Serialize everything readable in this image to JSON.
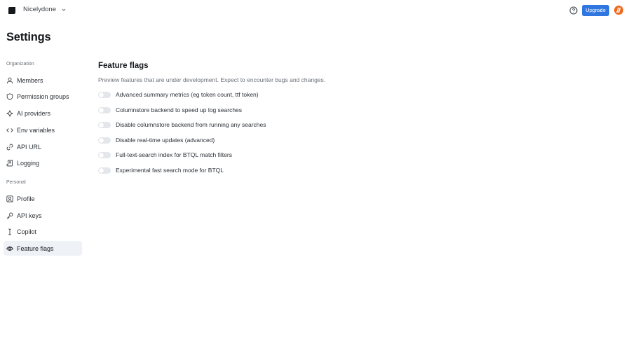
{
  "header": {
    "org_name": "Nicelydone",
    "upgrade_label": "Upgrade",
    "accent_color": "#2f76e0",
    "avatar_color": "#f0681e"
  },
  "page": {
    "title": "Settings"
  },
  "sidebar": {
    "organization_label": "Organization",
    "organization_items": [
      {
        "label": "Members",
        "icon": "user-icon"
      },
      {
        "label": "Permission groups",
        "icon": "shield-icon"
      },
      {
        "label": "AI providers",
        "icon": "sparkle-icon"
      },
      {
        "label": "Env variables",
        "icon": "code-icon"
      },
      {
        "label": "API URL",
        "icon": "link-icon"
      },
      {
        "label": "Logging",
        "icon": "log-icon"
      }
    ],
    "personal_label": "Personal",
    "personal_items": [
      {
        "label": "Profile",
        "icon": "profile-icon"
      },
      {
        "label": "API keys",
        "icon": "key-icon"
      },
      {
        "label": "Copilot",
        "icon": "text-cursor-icon"
      },
      {
        "label": "Feature flags",
        "icon": "eye-icon",
        "active": true
      }
    ]
  },
  "main": {
    "heading": "Feature flags",
    "description": "Preview features that are under development. Expect to encounter bugs and changes.",
    "flags": [
      {
        "label": "Advanced summary metrics (eg token count, ttf token)",
        "enabled": false
      },
      {
        "label": "Columnstore backend to speed up log searches",
        "enabled": false
      },
      {
        "label": "Disable columnstore backend from running any searches",
        "enabled": false
      },
      {
        "label": "Disable real-time updates (advanced)",
        "enabled": false
      },
      {
        "label": "Full-text-search index for BTQL match filters",
        "enabled": false
      },
      {
        "label": "Experimental fast search mode for BTQL",
        "enabled": false
      }
    ]
  }
}
